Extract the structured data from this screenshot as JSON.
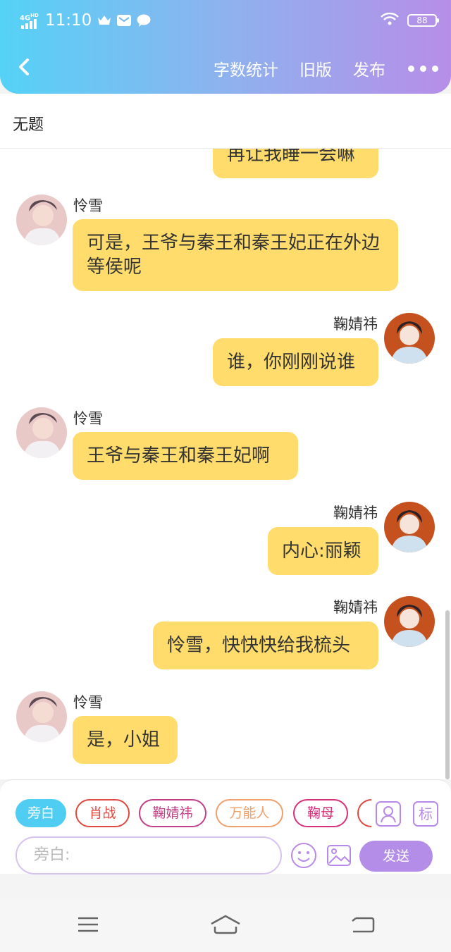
{
  "status_bar": {
    "network": "4G",
    "network_sup": "HD",
    "time": "11:10",
    "battery": "88"
  },
  "header": {
    "actions": [
      "字数统计",
      "旧版",
      "发布"
    ]
  },
  "title": "无题",
  "messages": [
    {
      "side": "right",
      "text": "再让我睡一会嘛"
    },
    {
      "side": "left",
      "name": "怜雪",
      "text": "可是，王爷与秦王和秦王妃正在外边等侯呢"
    },
    {
      "side": "right",
      "name": "鞠婧祎",
      "text": "谁，你刚刚说谁"
    },
    {
      "side": "left",
      "name": "怜雪",
      "text": "王爷与秦王和秦王妃啊"
    },
    {
      "side": "right",
      "name": "鞠婧祎",
      "text": "内心:丽颖"
    },
    {
      "side": "right",
      "name": "鞠婧祎",
      "text": "怜雪，快快快给我梳头"
    },
    {
      "side": "left",
      "name": "怜雪",
      "text": "是，小姐"
    }
  ],
  "roles": [
    "旁白",
    "肖战",
    "鞠婧祎",
    "万能人",
    "鞠母"
  ],
  "role_mark": "标",
  "input": {
    "placeholder": "旁白:"
  },
  "send_label": "发送",
  "colors": {
    "bubble": "#ffdc6b",
    "accent": "#b38de8",
    "active_chip": "#4fcdf2"
  }
}
